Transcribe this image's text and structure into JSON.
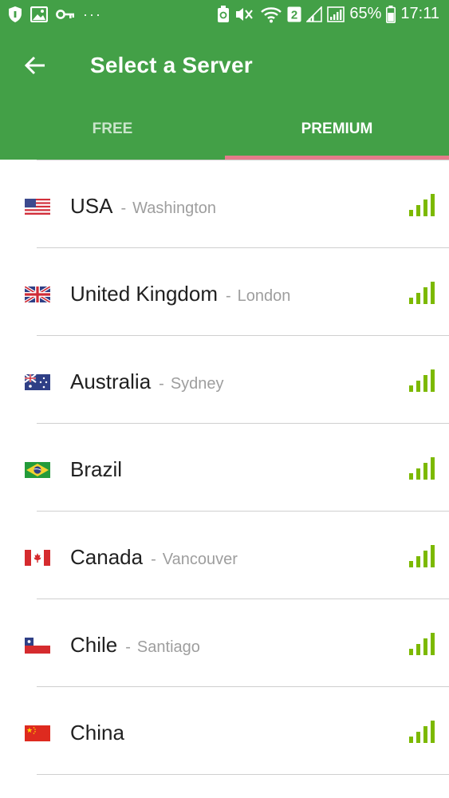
{
  "status_bar": {
    "battery": "65%",
    "time": "17:11",
    "sim_badge": "2",
    "left_icons": [
      "shield-icon",
      "image-icon",
      "key-icon"
    ],
    "more_dots": "···"
  },
  "toolbar": {
    "title": "Select a Server"
  },
  "tabs": [
    {
      "label": "FREE",
      "active": false
    },
    {
      "label": "PREMIUM",
      "active": true
    }
  ],
  "colors": {
    "header_green": "#43a047",
    "tab_indicator": "#e57b8a",
    "signal_green": "#7cb900"
  },
  "servers": [
    {
      "country": "USA",
      "city": "Washington",
      "flag": "us-flag-icon",
      "signal_bars": 4
    },
    {
      "country": "United Kingdom",
      "city": "London",
      "flag": "uk-flag-icon",
      "signal_bars": 4
    },
    {
      "country": "Australia",
      "city": "Sydney",
      "flag": "australia-flag-icon",
      "signal_bars": 4
    },
    {
      "country": "Brazil",
      "city": "",
      "flag": "brazil-flag-icon",
      "signal_bars": 4
    },
    {
      "country": "Canada",
      "city": "Vancouver",
      "flag": "canada-flag-icon",
      "signal_bars": 4
    },
    {
      "country": "Chile",
      "city": "Santiago",
      "flag": "chile-flag-icon",
      "signal_bars": 4
    },
    {
      "country": "China",
      "city": "",
      "flag": "china-flag-icon",
      "signal_bars": 4
    }
  ]
}
